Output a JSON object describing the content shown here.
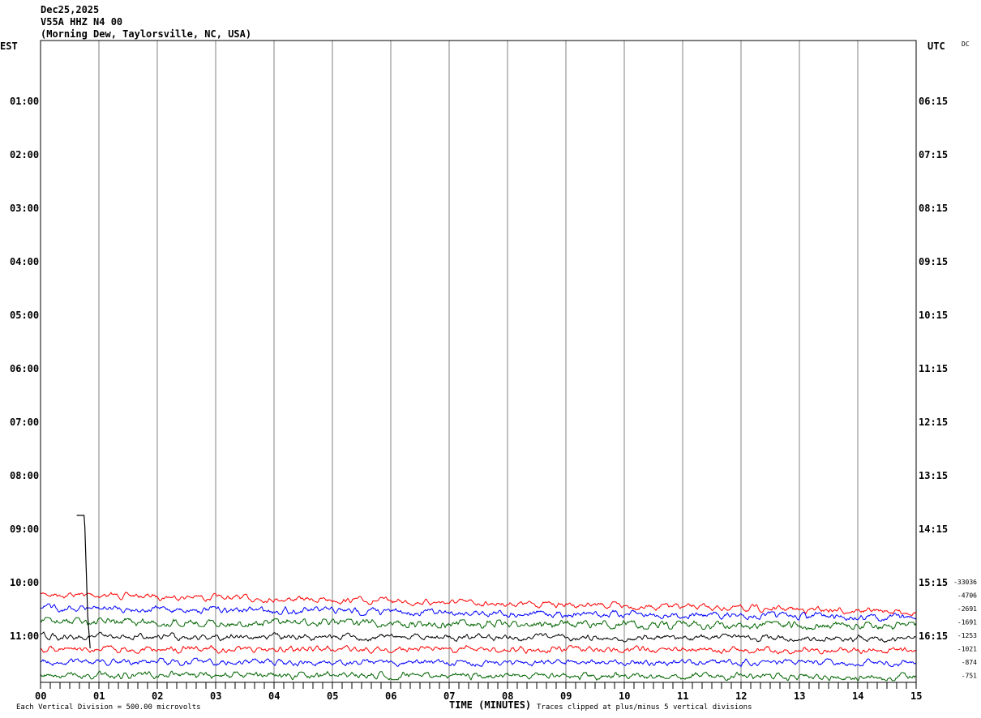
{
  "header": {
    "date": "Dec25,2025",
    "station": "V55A HHZ N4 00",
    "location": "(Morning Dew, Taylorsville, NC, USA)"
  },
  "left_timezone": "EST",
  "right_timezone": "UTC",
  "dc_label": "DC",
  "footer": {
    "scale_note": "Each Vertical Division =  500.00 microvolts",
    "xlabel": "TIME (MINUTES)",
    "clip_note": "Traces clipped at plus/minus 5 vertical divisions"
  },
  "chart_data": {
    "type": "line",
    "title": "",
    "xlabel": "TIME (MINUTES)",
    "x_ticks": [
      "00",
      "01",
      "02",
      "03",
      "04",
      "05",
      "06",
      "07",
      "08",
      "09",
      "10",
      "11",
      "12",
      "13",
      "14",
      "15"
    ],
    "xlim": [
      0,
      15
    ],
    "grid": "vertical lines every minute",
    "left_ticks": [
      "01:00",
      "02:00",
      "03:00",
      "04:00",
      "05:00",
      "06:00",
      "07:00",
      "08:00",
      "09:00",
      "10:00",
      "11:00"
    ],
    "right_ticks": [
      "06:15",
      "07:15",
      "08:15",
      "09:15",
      "10:15",
      "11:15",
      "12:15",
      "13:15",
      "14:15",
      "15:15",
      "16:15"
    ],
    "trace_offsets": [
      "-33036",
      "-4706",
      "-2691",
      "-1691",
      "-1253",
      "-1021",
      "-874",
      "-751"
    ],
    "traces": [
      {
        "color": "#ff0000",
        "row_time": "10:15",
        "amplitude": 2.0
      },
      {
        "color": "#0000ff",
        "row_time": "10:30",
        "amplitude": 2.4
      },
      {
        "color": "#006400",
        "row_time": "10:45",
        "amplitude": 3.0
      },
      {
        "color": "#000000",
        "row_time": "11:00",
        "amplitude": 2.2
      },
      {
        "color": "#ff0000",
        "row_time": "11:15",
        "amplitude": 2.2
      },
      {
        "color": "#0000ff",
        "row_time": "11:30",
        "amplitude": 2.2
      },
      {
        "color": "#006400",
        "row_time": "11:45",
        "amplitude": 2.4
      }
    ],
    "spike": {
      "color": "#000000",
      "start_minute": 0.62,
      "end_minute": 0.85
    }
  }
}
